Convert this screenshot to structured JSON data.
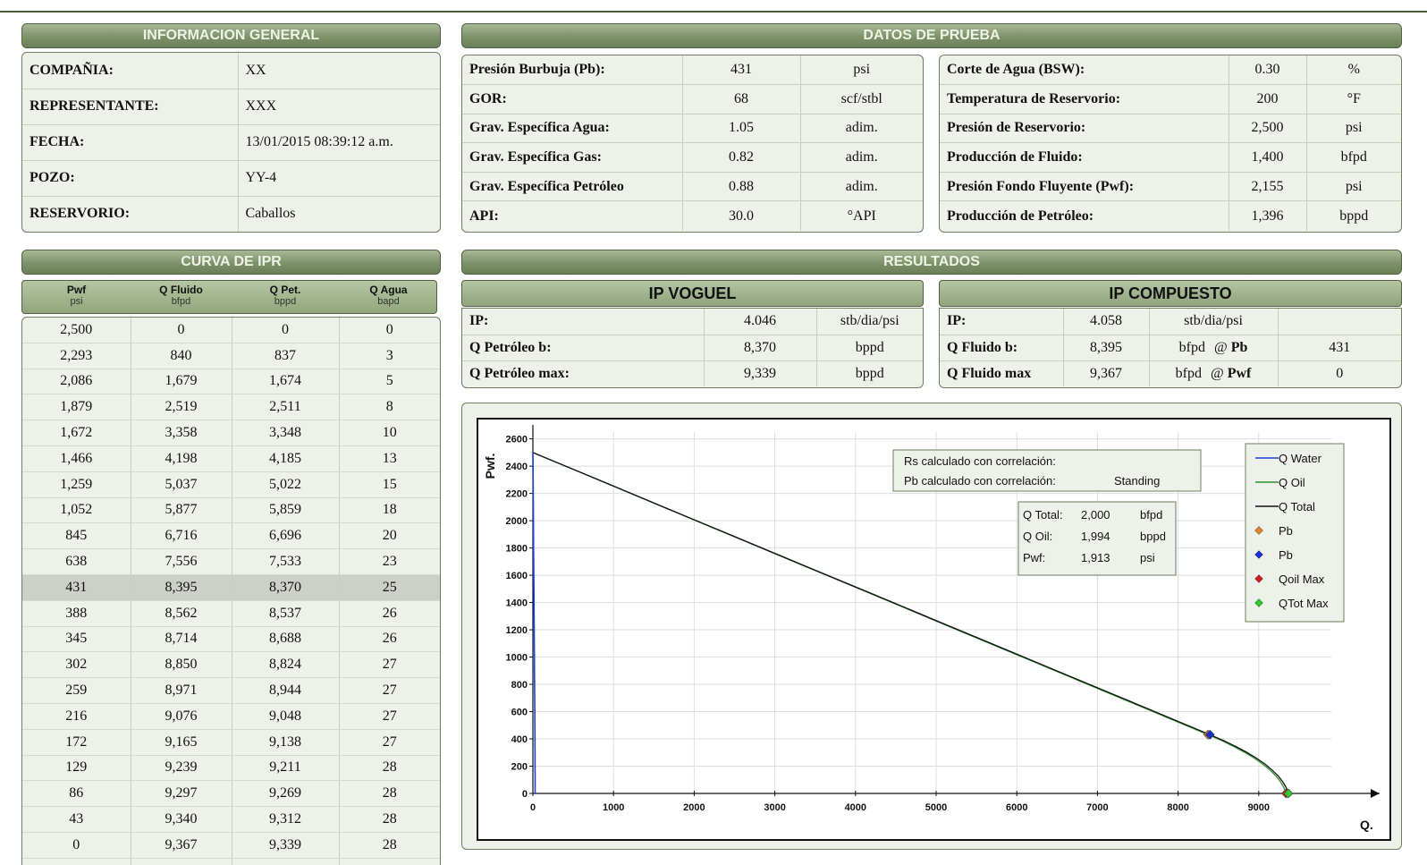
{
  "info_general": {
    "title": "INFORMACION GENERAL",
    "rows": [
      {
        "label": "COMPAÑIA:",
        "value": "XX"
      },
      {
        "label": "REPRESENTANTE:",
        "value": "XXX"
      },
      {
        "label": "FECHA:",
        "value": "13/01/2015 08:39:12 a.m."
      },
      {
        "label": "POZO:",
        "value": "YY-4"
      },
      {
        "label": "RESERVORIO:",
        "value": "Caballos"
      }
    ]
  },
  "datos_prueba": {
    "title": "DATOS DE PRUEBA",
    "left": [
      {
        "label": "Presión Burbuja (Pb):",
        "value": "431",
        "unit": "psi"
      },
      {
        "label": "GOR:",
        "value": "68",
        "unit": "scf/stbl"
      },
      {
        "label": "Grav. Específica Agua:",
        "value": "1.05",
        "unit": "adim."
      },
      {
        "label": "Grav. Específica Gas:",
        "value": "0.82",
        "unit": "adim."
      },
      {
        "label": "Grav.  Específica Petróleo",
        "value": "0.88",
        "unit": "adim."
      },
      {
        "label": "API:",
        "value": "30.0",
        "unit": "°API"
      }
    ],
    "right": [
      {
        "label": "Corte de Agua (BSW):",
        "value": "0.30",
        "unit": "%"
      },
      {
        "label": "Temperatura de Reservorio:",
        "value": "200",
        "unit": "°F"
      },
      {
        "label": "Presión de Reservorio:",
        "value": "2,500",
        "unit": "psi"
      },
      {
        "label": "Producción de Fluido:",
        "value": "1,400",
        "unit": "bfpd"
      },
      {
        "label": "Presión Fondo Fluyente (Pwf):",
        "value": "2,155",
        "unit": "psi"
      },
      {
        "label": "Producción de Petróleo:",
        "value": "1,396",
        "unit": "bppd"
      }
    ]
  },
  "curva_ipr": {
    "title": "CURVA DE IPR",
    "columns": [
      {
        "name": "Pwf",
        "unit": "psi"
      },
      {
        "name": "Q Fluido",
        "unit": "bfpd"
      },
      {
        "name": "Q Pet.",
        "unit": "bppd"
      },
      {
        "name": "Q Agua",
        "unit": "bapd"
      }
    ],
    "rows": [
      [
        "2,500",
        "0",
        "0",
        "0"
      ],
      [
        "2,293",
        "840",
        "837",
        "3"
      ],
      [
        "2,086",
        "1,679",
        "1,674",
        "5"
      ],
      [
        "1,879",
        "2,519",
        "2,511",
        "8"
      ],
      [
        "1,672",
        "3,358",
        "3,348",
        "10"
      ],
      [
        "1,466",
        "4,198",
        "4,185",
        "13"
      ],
      [
        "1,259",
        "5,037",
        "5,022",
        "15"
      ],
      [
        "1,052",
        "5,877",
        "5,859",
        "18"
      ],
      [
        "845",
        "6,716",
        "6,696",
        "20"
      ],
      [
        "638",
        "7,556",
        "7,533",
        "23"
      ],
      [
        "431",
        "8,395",
        "8,370",
        "25"
      ],
      [
        "388",
        "8,562",
        "8,537",
        "26"
      ],
      [
        "345",
        "8,714",
        "8,688",
        "26"
      ],
      [
        "302",
        "8,850",
        "8,824",
        "27"
      ],
      [
        "259",
        "8,971",
        "8,944",
        "27"
      ],
      [
        "216",
        "9,076",
        "9,048",
        "27"
      ],
      [
        "172",
        "9,165",
        "9,138",
        "27"
      ],
      [
        "129",
        "9,239",
        "9,211",
        "28"
      ],
      [
        "86",
        "9,297",
        "9,269",
        "28"
      ],
      [
        "43",
        "9,340",
        "9,312",
        "28"
      ],
      [
        "0",
        "9,367",
        "9,339",
        "28"
      ]
    ],
    "highlight_row": 10
  },
  "resultados": {
    "title": "RESULTADOS",
    "voguel": {
      "title": "IP VOGUEL",
      "rows": [
        {
          "label": "IP:",
          "value": "4.046",
          "unit": "stb/dia/psi"
        },
        {
          "label": "Q Petróleo b:",
          "value": "8,370",
          "unit": "bppd"
        },
        {
          "label": "Q Petróleo max:",
          "value": "9,339",
          "unit": "bppd"
        }
      ]
    },
    "compuesto": {
      "title": "IP COMPUESTO",
      "rows": [
        {
          "label": "IP:",
          "value": "4.058",
          "unit": "stb/dia/psi",
          "at": "",
          "at_value": ""
        },
        {
          "label": "Q Fluido b:",
          "value": "8,395",
          "unit": "bfpd",
          "at": "@ Pb",
          "at_value": "431"
        },
        {
          "label": "Q Fluido max",
          "value": "9,367",
          "unit": "bfpd",
          "at": "@ Pwf",
          "at_value": "0"
        }
      ]
    }
  },
  "chart_data": {
    "type": "line",
    "xlabel": "Q.",
    "ylabel": "Pwf.",
    "xlim": [
      0,
      9900
    ],
    "ylim": [
      0,
      2650
    ],
    "x_ticks": [
      0,
      1000,
      2000,
      3000,
      4000,
      5000,
      6000,
      7000,
      8000,
      9000
    ],
    "y_ticks": [
      0,
      200,
      400,
      600,
      800,
      1000,
      1200,
      1400,
      1600,
      1800,
      2000,
      2200,
      2400,
      2600
    ],
    "pwf": [
      2500,
      2293,
      2086,
      1879,
      1672,
      1466,
      1259,
      1052,
      845,
      638,
      431,
      388,
      345,
      302,
      259,
      216,
      172,
      129,
      86,
      43,
      0
    ],
    "series": [
      {
        "name": "Q Water",
        "color": "#1f3fd6",
        "values": [
          0,
          3,
          5,
          8,
          10,
          13,
          15,
          18,
          20,
          23,
          25,
          26,
          26,
          27,
          27,
          27,
          27,
          28,
          28,
          28,
          28
        ]
      },
      {
        "name": "Q Oil",
        "color": "#2f8f2f",
        "values": [
          0,
          837,
          1674,
          2511,
          3348,
          4185,
          5022,
          5859,
          6696,
          7533,
          8370,
          8537,
          8688,
          8824,
          8944,
          9048,
          9138,
          9211,
          9269,
          9312,
          9339
        ]
      },
      {
        "name": "Q Total",
        "color": "#111111",
        "values": [
          0,
          840,
          1679,
          2519,
          3358,
          4198,
          5037,
          5877,
          6716,
          7556,
          8395,
          8562,
          8714,
          8850,
          8971,
          9076,
          9165,
          9239,
          9297,
          9340,
          9367
        ]
      }
    ],
    "markers": [
      {
        "name": "Pb",
        "color": "#e8812a",
        "x": 8370,
        "y": 431
      },
      {
        "name": "Pb",
        "color": "#1a2fd0",
        "x": 8395,
        "y": 431
      },
      {
        "name": "Qoil Max",
        "color": "#d42020",
        "x": 9339,
        "y": 0
      },
      {
        "name": "QTot Max",
        "color": "#2ec92e",
        "x": 9367,
        "y": 0
      }
    ],
    "legend_position": "top-right",
    "annotation_rs": {
      "line1": "Rs calculado con correlación:",
      "line2": "Pb calculado con correlación:",
      "line2_value": "Standing"
    },
    "info_box": [
      {
        "label": "Q Total:",
        "value": "2,000",
        "unit": "bfpd"
      },
      {
        "label": "Q Oil:",
        "value": "1,994",
        "unit": "bppd"
      },
      {
        "label": "Pwf:",
        "value": "1,913",
        "unit": "psi"
      }
    ]
  }
}
